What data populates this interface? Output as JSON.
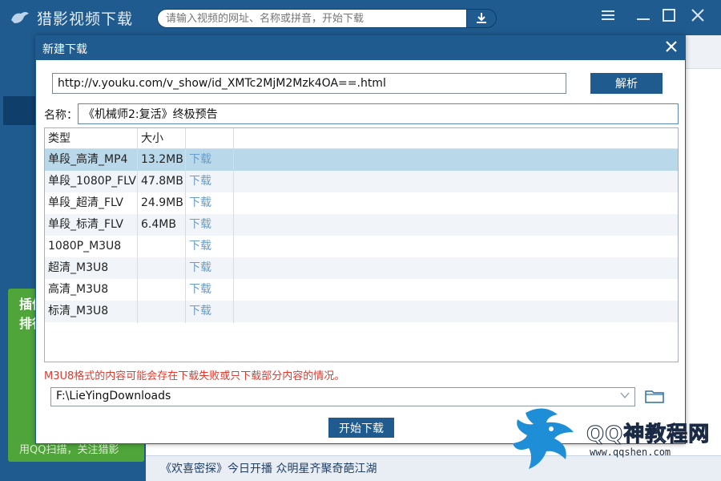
{
  "app": {
    "logo_text": "猎影视频下载",
    "search_placeholder": "请输入视频的网址、名称或拼音，开始下载",
    "sidebar_promo": "插件\n排行",
    "sidebar_footer": "用QQ扫描，关注猎影",
    "bottom_news": "《欢喜密探》今日开播 众明星齐聚奇葩江湖"
  },
  "dialog": {
    "title": "新建下载",
    "url_value": "http://v.youku.com/v_show/id_XMTc2MjM2Mzk4OA==.html",
    "parse_label": "解析",
    "name_label": "名称：",
    "name_value": "《机械师2:复活》终极预告",
    "table": {
      "headers": [
        "类型",
        "大小",
        ""
      ],
      "rows": [
        {
          "type": "单段_高清_MP4",
          "size": "13.2MB",
          "action": "下载",
          "selected": true
        },
        {
          "type": "单段_1080P_FLV",
          "size": "47.8MB",
          "action": "下载",
          "selected": false
        },
        {
          "type": "单段_超清_FLV",
          "size": "24.9MB",
          "action": "下载",
          "selected": false
        },
        {
          "type": "单段_标清_FLV",
          "size": "6.4MB",
          "action": "下载",
          "selected": false
        },
        {
          "type": "1080P_M3U8",
          "size": "",
          "action": "下载",
          "selected": false
        },
        {
          "type": "超清_M3U8",
          "size": "",
          "action": "下载",
          "selected": false
        },
        {
          "type": "高清_M3U8",
          "size": "",
          "action": "下载",
          "selected": false
        },
        {
          "type": "标清_M3U8",
          "size": "",
          "action": "下载",
          "selected": false
        }
      ]
    },
    "warning": "M3U8格式的内容可能会存在下载失败或只下载部分内容的情况。",
    "save_dir": "F:\\LieYingDownloads",
    "start_label": "开始下载"
  },
  "watermark": {
    "text": "QQ神教程网",
    "url": "www.qqshen.com"
  },
  "colors": {
    "primary": "#1f5b8e",
    "selected_row": "#b9d8ea",
    "alt_row": "#f1f5fa",
    "link": "#6a9cc8",
    "warning": "#e03a2f",
    "promo_green": "#4fa53a"
  },
  "icons": [
    "logo-icon",
    "download-arrow-icon",
    "menu-icon",
    "minimize-icon",
    "maximize-icon",
    "close-icon",
    "dialog-close-icon",
    "dropdown-chevron-icon",
    "folder-icon",
    "dragon-logo-icon"
  ]
}
